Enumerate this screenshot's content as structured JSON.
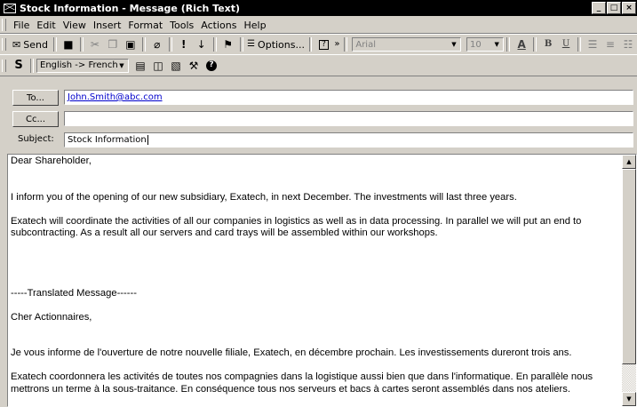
{
  "window": {
    "title": "Stock Information - Message (Rich Text)",
    "controls": [
      "_",
      "□",
      "×"
    ]
  },
  "menu": [
    "File",
    "Edit",
    "View",
    "Insert",
    "Format",
    "Tools",
    "Actions",
    "Help"
  ],
  "toolbar": {
    "send_label": "Send",
    "options_label": "Options...",
    "font_name": "Arial",
    "font_size": "10",
    "icons": [
      "save-icon",
      "cut-icon",
      "copy-icon",
      "paste-icon",
      "attach-icon",
      "importance-high-icon",
      "importance-low-icon",
      "flag-icon",
      "help-icon",
      "chevron-icon",
      "font-color-icon",
      "bold-icon",
      "underline-icon",
      "align-left-icon",
      "align-center-icon",
      "bullets-icon"
    ]
  },
  "translate_toolbar": {
    "language_pair": "English -> French"
  },
  "header": {
    "to_button": "To...",
    "to_value": "John.Smith@abc.com",
    "cc_button": "Cc...",
    "cc_value": "",
    "subject_label": "Subject:",
    "subject_value": "Stock Information"
  },
  "message_body": [
    "Dear Shareholder,",
    "",
    "",
    "I inform you of the opening of our new subsidiary, Exatech, in next December. The investments will last three years.",
    "",
    "Exatech will coordinate the activities of all our companies in logistics as well as in data processing. In parallel we will put an end to subcontracting. As a result all our servers and card trays will be assembled within our workshops.",
    "",
    "",
    "",
    "",
    "-----Translated Message------",
    "",
    "Cher Actionnaires,",
    "",
    "",
    "Je vous informe de l'ouverture de notre nouvelle filiale, Exatech, en décembre prochain. Les investissements dureront trois ans.",
    "",
    "Exatech coordonnera les activités de toutes nos compagnies dans la logistique aussi bien que dans l'informatique. En parallèle nous mettrons un terme à la sous-traitance. En conséquence tous nos serveurs et bacs à cartes seront assemblés dans nos ateliers."
  ]
}
